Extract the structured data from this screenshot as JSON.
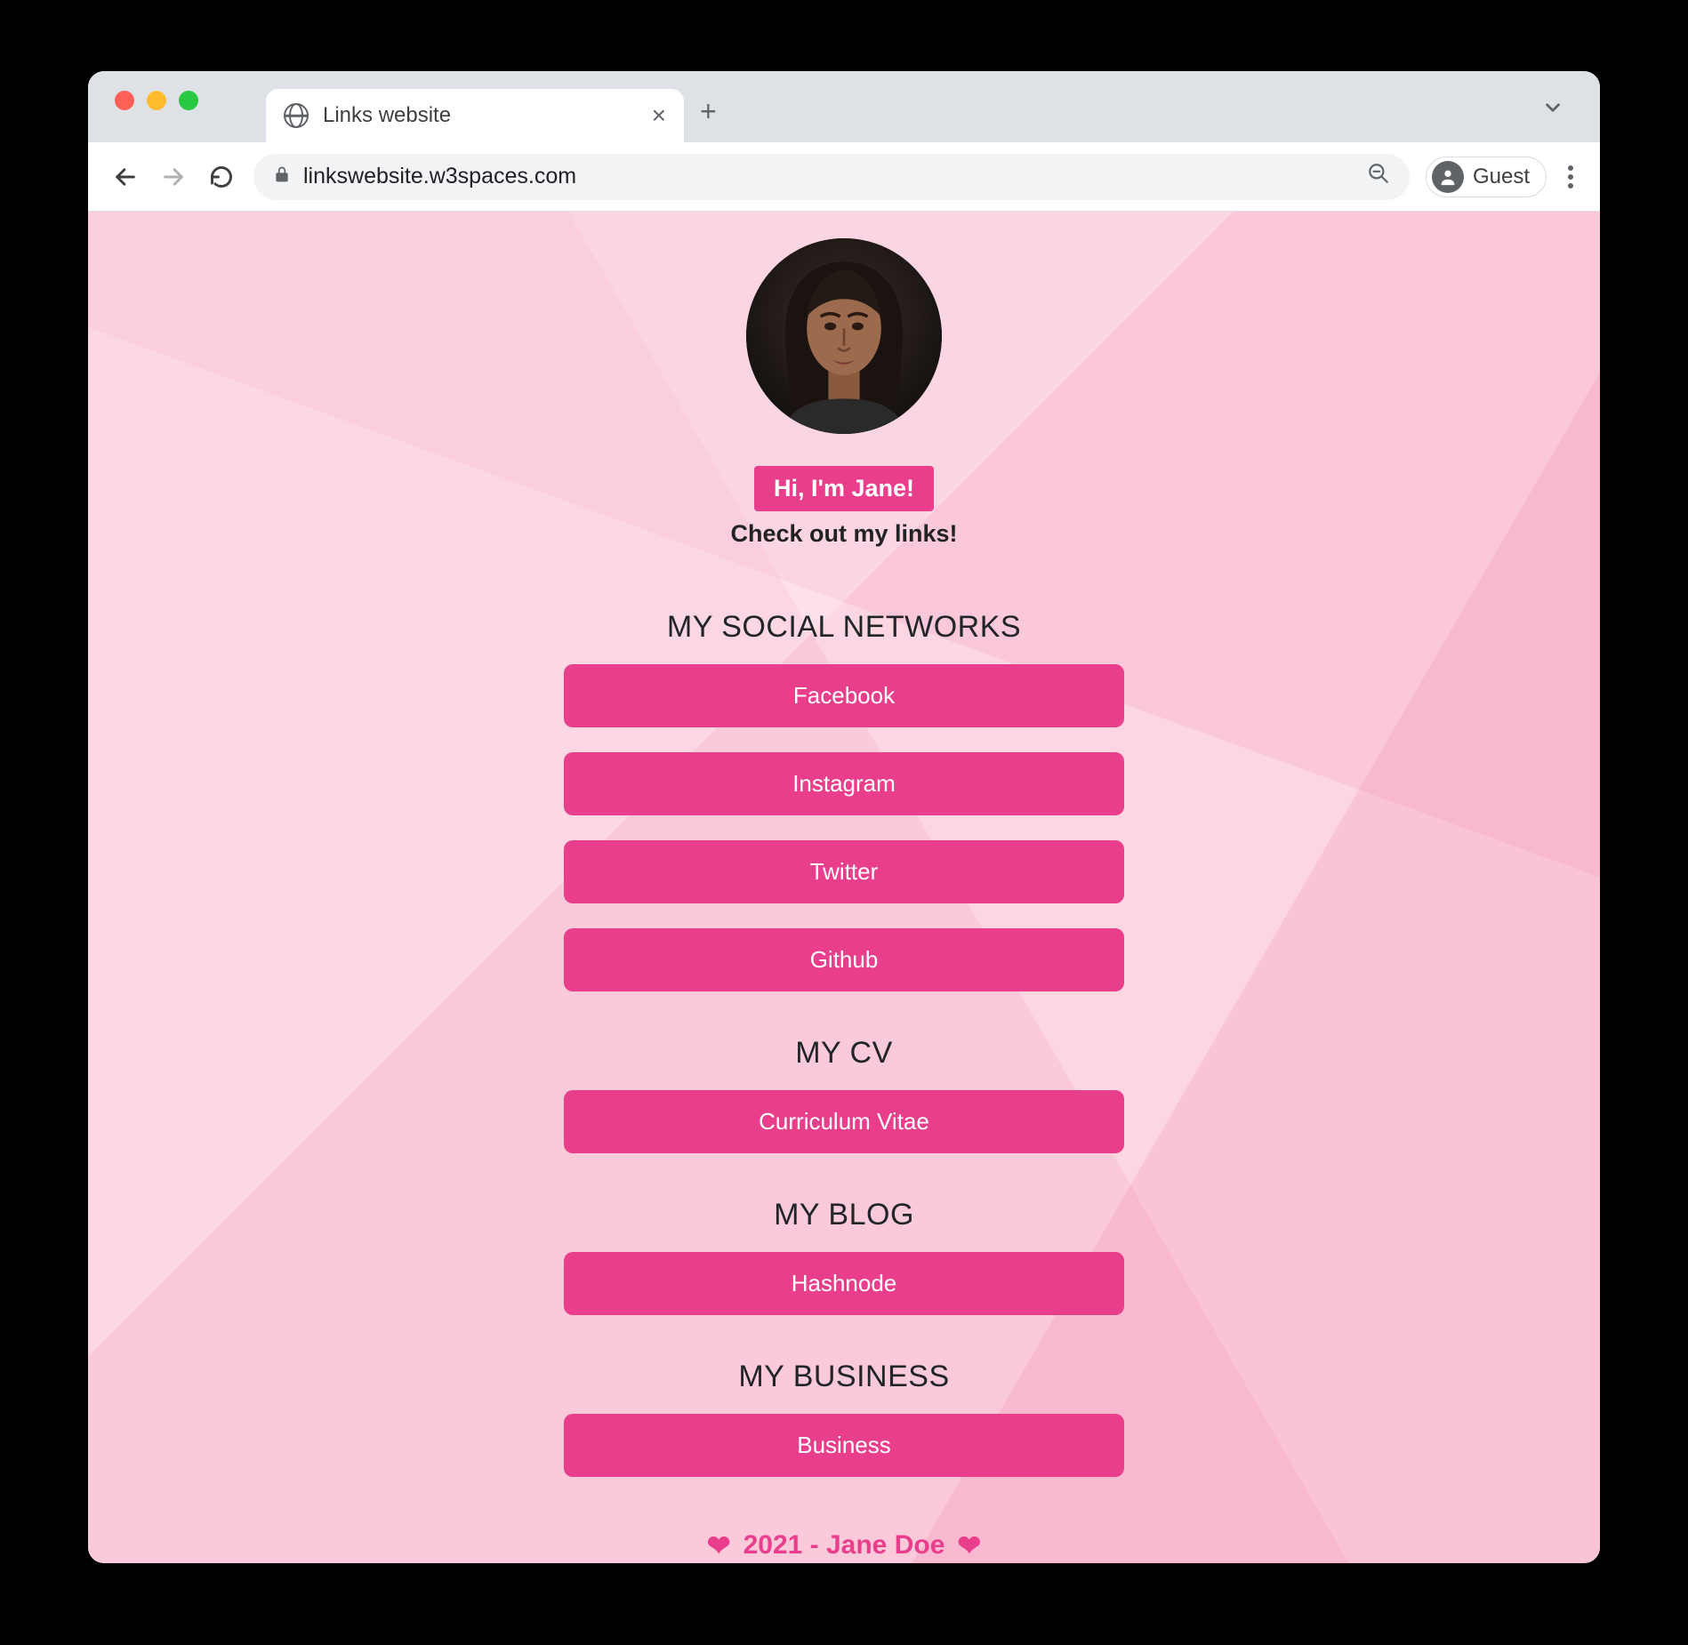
{
  "browser": {
    "tab_title": "Links website",
    "url": "linkswebsite.w3spaces.com",
    "guest_label": "Guest"
  },
  "profile": {
    "greeting": "Hi, I'm Jane!",
    "subtitle": "Check out my links!"
  },
  "sections": {
    "social": {
      "heading": "MY SOCIAL NETWORKS",
      "links": [
        "Facebook",
        "Instagram",
        "Twitter",
        "Github"
      ]
    },
    "cv": {
      "heading": "MY CV",
      "links": [
        "Curriculum Vitae"
      ]
    },
    "blog": {
      "heading": "MY BLOG",
      "links": [
        "Hashnode"
      ]
    },
    "business": {
      "heading": "MY BUSINESS",
      "links": [
        "Business"
      ]
    }
  },
  "footer": {
    "text": "2021 - Jane Doe"
  },
  "colors": {
    "accent": "#e83e8c",
    "page_bg": "#fcd6e1"
  }
}
